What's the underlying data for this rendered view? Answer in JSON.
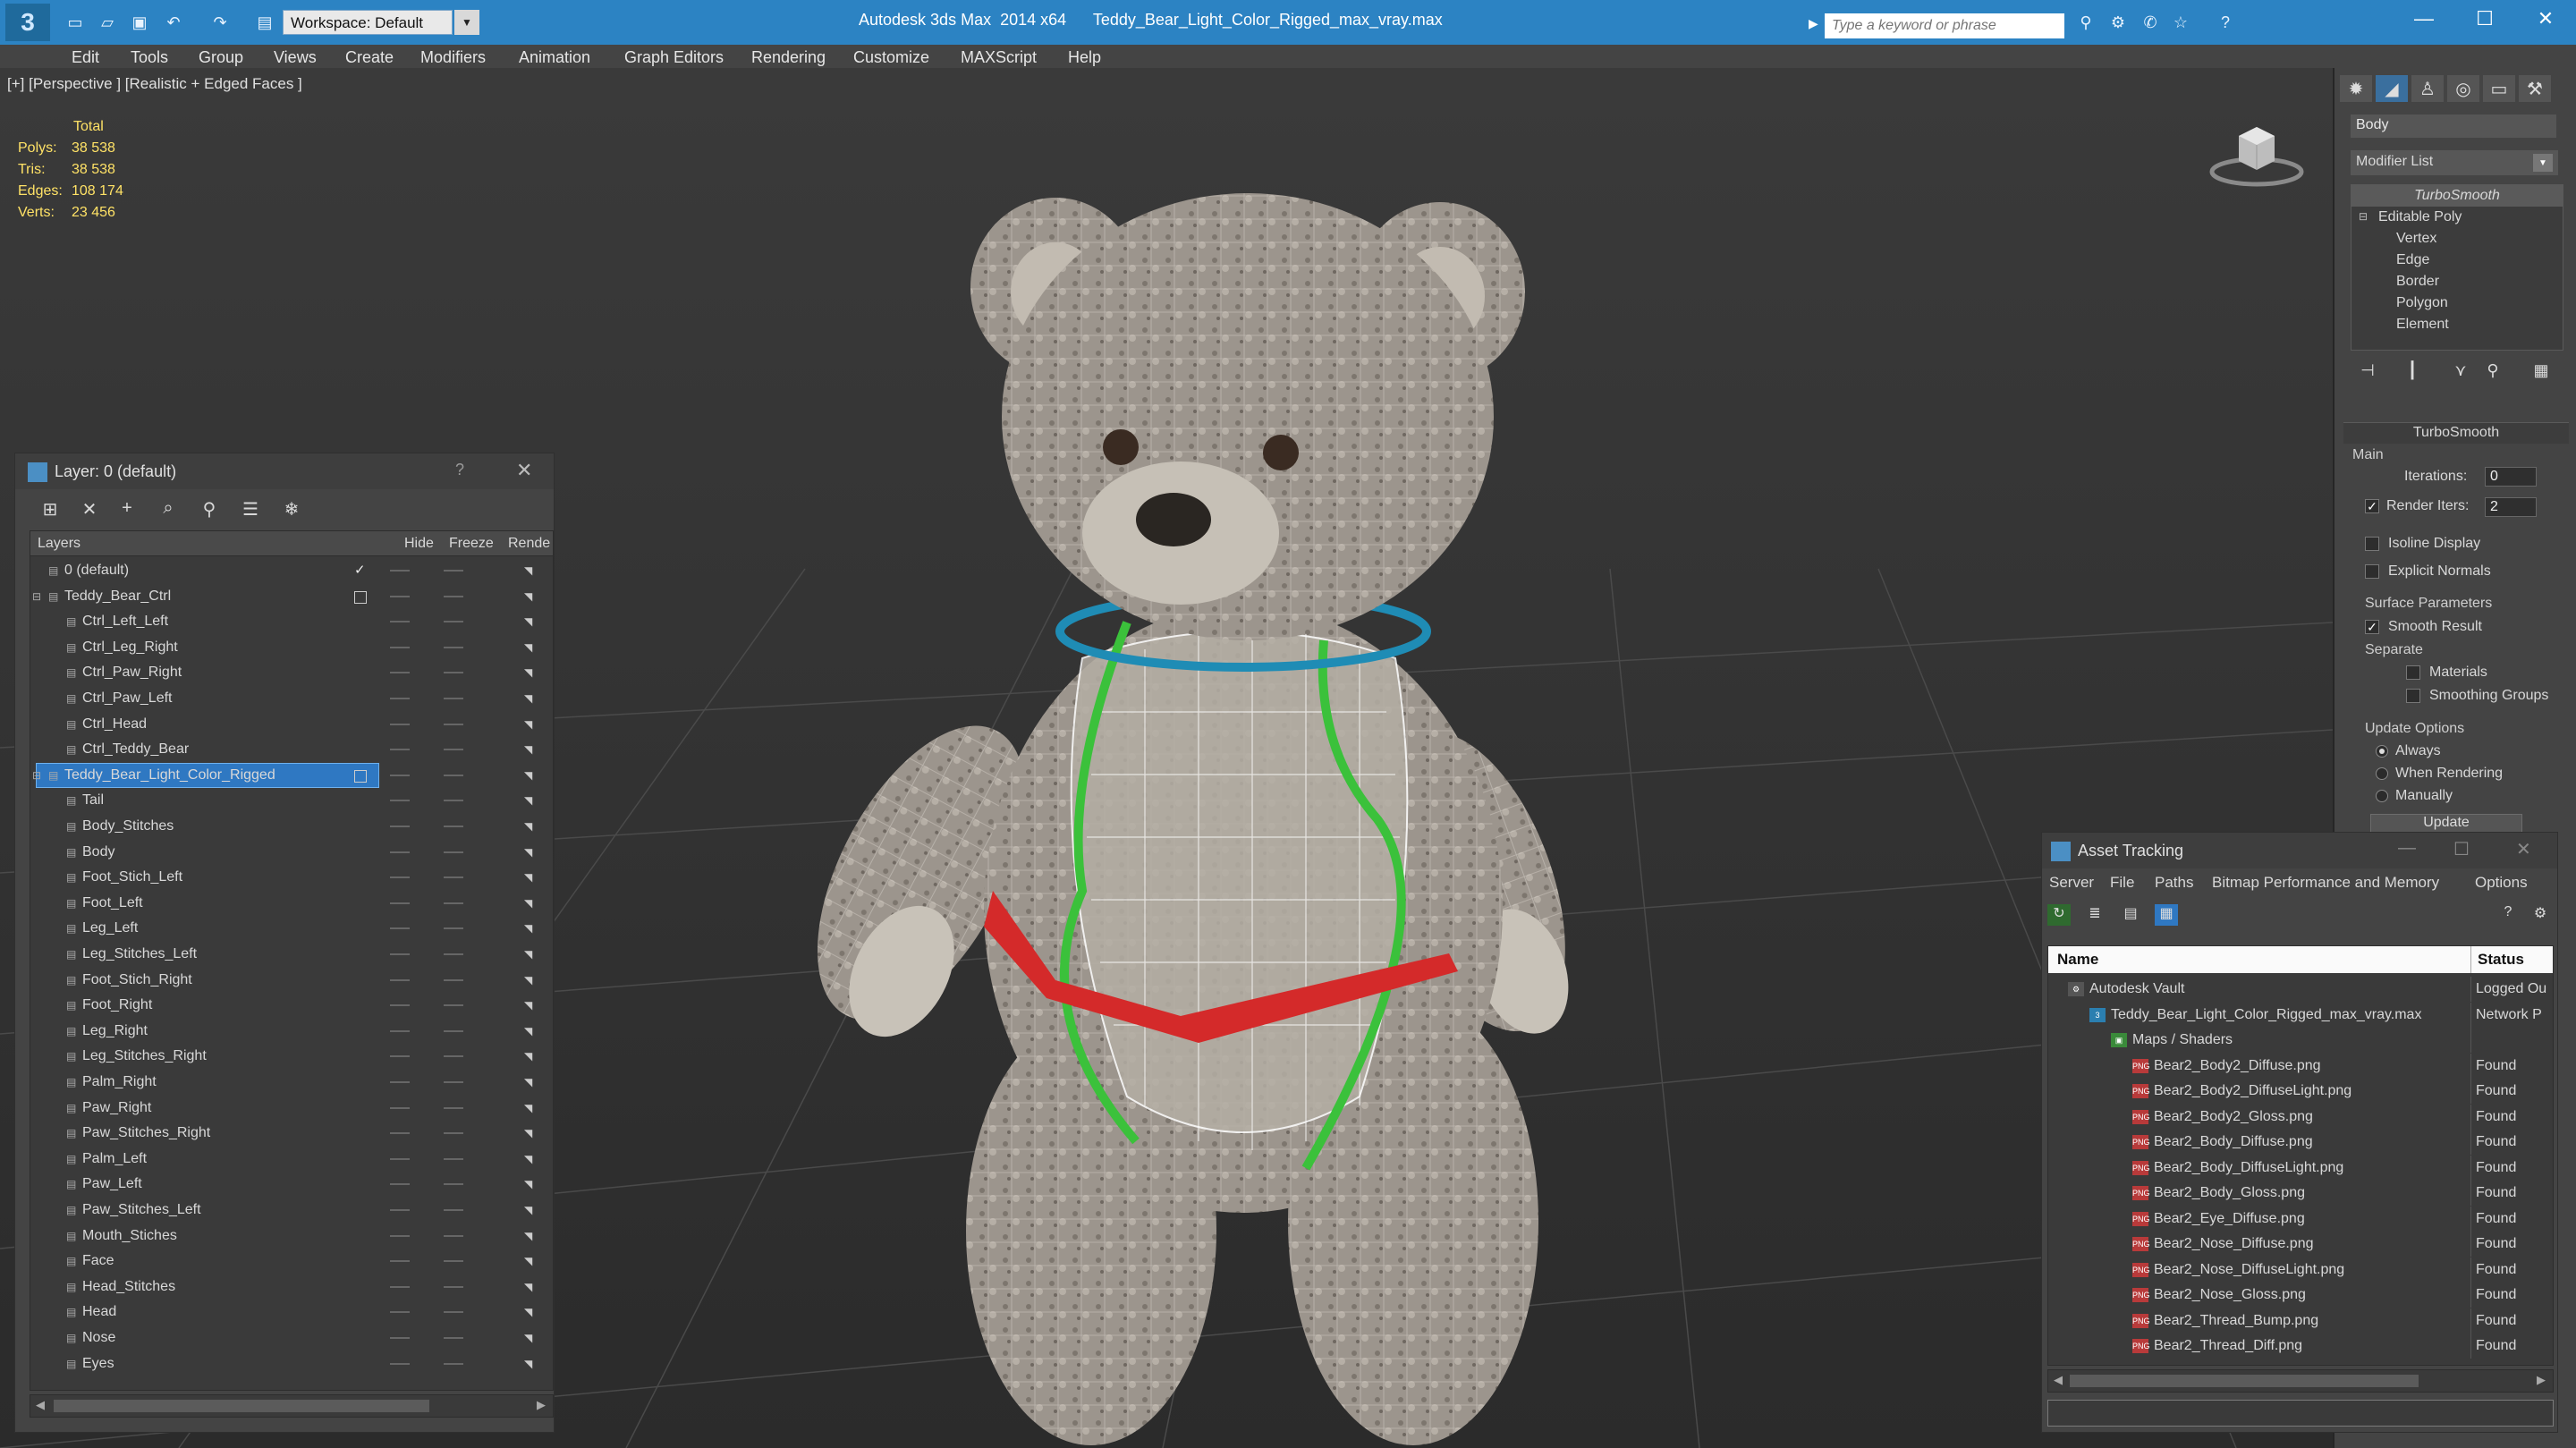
{
  "app": {
    "logo_text": "3",
    "title": "Autodesk 3ds Max  2014 x64      Teddy_Bear_Light_Color_Rigged_max_vray.max",
    "workspace": "Workspace: Default",
    "search_placeholder": "Type a keyword or phrase",
    "window_controls": [
      "—",
      "☐",
      "✕"
    ]
  },
  "menu": [
    "Edit",
    "Tools",
    "Group",
    "Views",
    "Create",
    "Modifiers",
    "Animation",
    "Graph Editors",
    "Rendering",
    "Customize",
    "MAXScript",
    "Help"
  ],
  "viewport": {
    "label": "[+] [Perspective ] [Realistic + Edged Faces ]",
    "stats_header": "Total",
    "stats": [
      {
        "label": "Polys:",
        "value": "38 538"
      },
      {
        "label": "Tris:",
        "value": "38 538"
      },
      {
        "label": "Edges:",
        "value": "108 174"
      },
      {
        "label": "Verts:",
        "value": "23 456"
      }
    ]
  },
  "command_panel": {
    "object_name": "Body",
    "modifier_list": "Modifier List",
    "stack": [
      {
        "label": "TurboSmooth",
        "level": 0
      },
      {
        "label": "Editable Poly",
        "level": 0
      },
      {
        "label": "Vertex",
        "level": 1
      },
      {
        "label": "Edge",
        "level": 1
      },
      {
        "label": "Border",
        "level": 1
      },
      {
        "label": "Polygon",
        "level": 1
      },
      {
        "label": "Element",
        "level": 1
      }
    ],
    "rollout_title": "TurboSmooth",
    "main_group": "Main",
    "iterations_label": "Iterations:",
    "iterations_value": "0",
    "render_iters_label": "Render Iters:",
    "render_iters_value": "2",
    "isoline_label": "Isoline Display",
    "explicit_normals_label": "Explicit Normals",
    "surface_group": "Surface Parameters",
    "smooth_result_label": "Smooth Result",
    "separate_label": "Separate",
    "materials_label": "Materials",
    "smoothing_groups_label": "Smoothing Groups",
    "update_group": "Update Options",
    "always_label": "Always",
    "when_rendering_label": "When Rendering",
    "manually_label": "Manually",
    "update_button": "Update",
    "accent_color": "#2f78c2"
  },
  "layer_dialog": {
    "title": "Layer: 0 (default)",
    "help": "?",
    "close": "✕",
    "columns": {
      "layers": "Layers",
      "hide": "Hide",
      "freeze": "Freeze",
      "render": "Rende"
    },
    "rows": [
      {
        "name": "0 (default)",
        "indent": 1,
        "checked": true
      },
      {
        "name": "Teddy_Bear_Ctrl",
        "indent": 1,
        "box": true,
        "expand": true
      },
      {
        "name": "Ctrl_Left_Left",
        "indent": 2
      },
      {
        "name": "Ctrl_Leg_Right",
        "indent": 2
      },
      {
        "name": "Ctrl_Paw_Right",
        "indent": 2
      },
      {
        "name": "Ctrl_Paw_Left",
        "indent": 2
      },
      {
        "name": "Ctrl_Head",
        "indent": 2
      },
      {
        "name": "Ctrl_Teddy_Bear",
        "indent": 2
      },
      {
        "name": "Teddy_Bear_Light_Color_Rigged",
        "indent": 1,
        "box": true,
        "expand": true,
        "selected": true
      },
      {
        "name": "Tail",
        "indent": 2
      },
      {
        "name": "Body_Stitches",
        "indent": 2
      },
      {
        "name": "Body",
        "indent": 2
      },
      {
        "name": "Foot_Stich_Left",
        "indent": 2
      },
      {
        "name": "Foot_Left",
        "indent": 2
      },
      {
        "name": "Leg_Left",
        "indent": 2
      },
      {
        "name": "Leg_Stitches_Left",
        "indent": 2
      },
      {
        "name": "Foot_Stich_Right",
        "indent": 2
      },
      {
        "name": "Foot_Right",
        "indent": 2
      },
      {
        "name": "Leg_Right",
        "indent": 2
      },
      {
        "name": "Leg_Stitches_Right",
        "indent": 2
      },
      {
        "name": "Palm_Right",
        "indent": 2
      },
      {
        "name": "Paw_Right",
        "indent": 2
      },
      {
        "name": "Paw_Stitches_Right",
        "indent": 2
      },
      {
        "name": "Palm_Left",
        "indent": 2
      },
      {
        "name": "Paw_Left",
        "indent": 2
      },
      {
        "name": "Paw_Stitches_Left",
        "indent": 2
      },
      {
        "name": "Mouth_Stiches",
        "indent": 2
      },
      {
        "name": "Face",
        "indent": 2
      },
      {
        "name": "Head_Stitches",
        "indent": 2
      },
      {
        "name": "Head",
        "indent": 2
      },
      {
        "name": "Nose",
        "indent": 2
      },
      {
        "name": "Eyes",
        "indent": 2
      }
    ]
  },
  "asset_dialog": {
    "title": "Asset Tracking",
    "menu": [
      "Server",
      "File",
      "Paths",
      "Bitmap Performance and Memory",
      "Options"
    ],
    "columns": {
      "name": "Name",
      "status": "Status"
    },
    "rows": [
      {
        "name": "Autodesk Vault",
        "status": "Logged Ou",
        "indent": 0,
        "icon": "vault"
      },
      {
        "name": "Teddy_Bear_Light_Color_Rigged_max_vray.max",
        "status": "Network P",
        "indent": 1,
        "icon": "max"
      },
      {
        "name": "Maps / Shaders",
        "status": "",
        "indent": 2,
        "icon": "folder"
      },
      {
        "name": "Bear2_Body2_Diffuse.png",
        "status": "Found",
        "indent": 3,
        "icon": "png"
      },
      {
        "name": "Bear2_Body2_DiffuseLight.png",
        "status": "Found",
        "indent": 3,
        "icon": "png"
      },
      {
        "name": "Bear2_Body2_Gloss.png",
        "status": "Found",
        "indent": 3,
        "icon": "png"
      },
      {
        "name": "Bear2_Body_Diffuse.png",
        "status": "Found",
        "indent": 3,
        "icon": "png"
      },
      {
        "name": "Bear2_Body_DiffuseLight.png",
        "status": "Found",
        "indent": 3,
        "icon": "png"
      },
      {
        "name": "Bear2_Body_Gloss.png",
        "status": "Found",
        "indent": 3,
        "icon": "png"
      },
      {
        "name": "Bear2_Eye_Diffuse.png",
        "status": "Found",
        "indent": 3,
        "icon": "png"
      },
      {
        "name": "Bear2_Nose_Diffuse.png",
        "status": "Found",
        "indent": 3,
        "icon": "png"
      },
      {
        "name": "Bear2_Nose_DiffuseLight.png",
        "status": "Found",
        "indent": 3,
        "icon": "png"
      },
      {
        "name": "Bear2_Nose_Gloss.png",
        "status": "Found",
        "indent": 3,
        "icon": "png"
      },
      {
        "name": "Bear2_Thread_Bump.png",
        "status": "Found",
        "indent": 3,
        "icon": "png"
      },
      {
        "name": "Bear2_Thread_Diff.png",
        "status": "Found",
        "indent": 3,
        "icon": "png"
      }
    ]
  }
}
